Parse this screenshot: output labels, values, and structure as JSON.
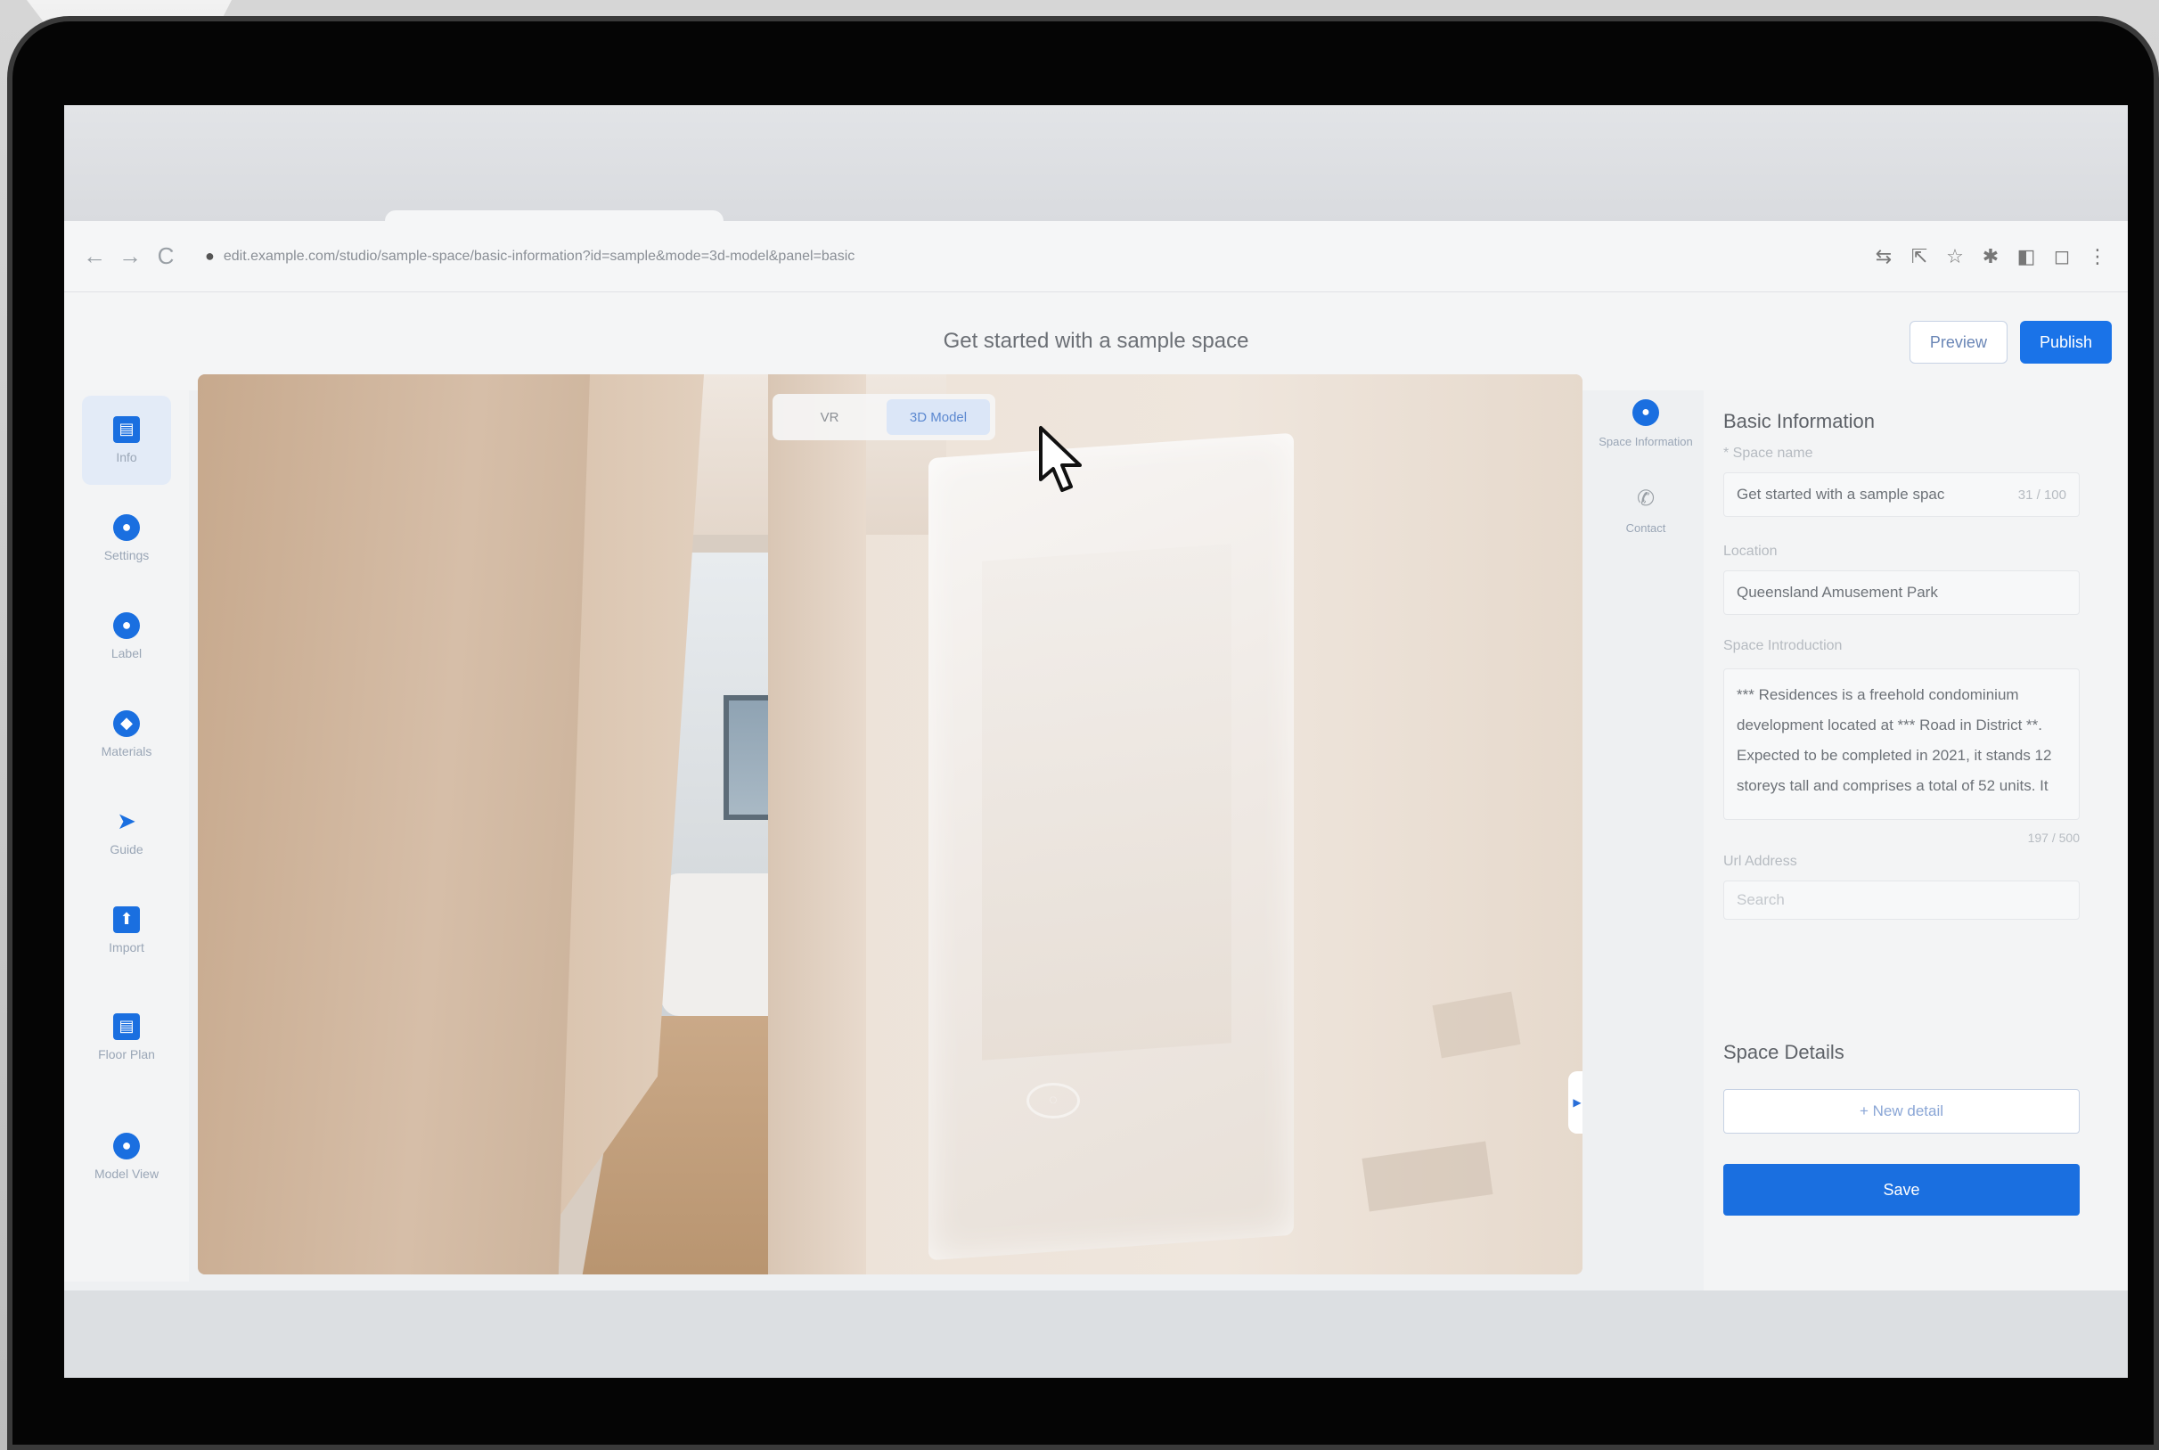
{
  "browser": {
    "url": "edit.example.com/studio/sample-space/basic-information?id=sample&mode=3d-model&panel=basic",
    "nav": {
      "back": "←",
      "forward": "→",
      "reload": "C"
    }
  },
  "header": {
    "title": "Get started with a sample space",
    "preview_label": "Preview",
    "publish_label": "Publish"
  },
  "sidebar": {
    "items": [
      {
        "label": "Info",
        "icon": "▤"
      },
      {
        "label": "Settings",
        "icon": "●"
      },
      {
        "label": "Label",
        "icon": "●"
      },
      {
        "label": "Materials",
        "icon": "◆"
      },
      {
        "label": "Guide",
        "icon": "➤"
      },
      {
        "label": "Import",
        "icon": "⬆"
      },
      {
        "label": "Floor Plan",
        "icon": "▤"
      },
      {
        "label": "Model View",
        "icon": "●"
      }
    ]
  },
  "viewer": {
    "modes": [
      "VR",
      "3D Model"
    ],
    "active_mode": "3D Model"
  },
  "right_tabs": [
    {
      "label": "Space Information"
    },
    {
      "label": "Contact"
    }
  ],
  "panel": {
    "basic_title": "Basic Information",
    "space_name_label": "* Space name",
    "space_name_value": "Get started with a sample spac",
    "space_name_count": "31 / 100",
    "location_label": "Location",
    "location_value": "Queensland Amusement Park",
    "intro_label": "Space Introduction",
    "intro_text": "*** Residences is a freehold condominium development located at *** Road in District **. Expected to be completed in 2021, it stands 12 storeys tall and comprises a total of 52 units. It",
    "intro_count": "197 / 500",
    "url_label": "Url Address",
    "url_placeholder": "Search",
    "details_title": "Space Details",
    "add_detail_label": "+  New detail",
    "save_label": "Save"
  },
  "colors": {
    "accent": "#1a73e8",
    "sidebar_icon": "#1a6fe0"
  }
}
